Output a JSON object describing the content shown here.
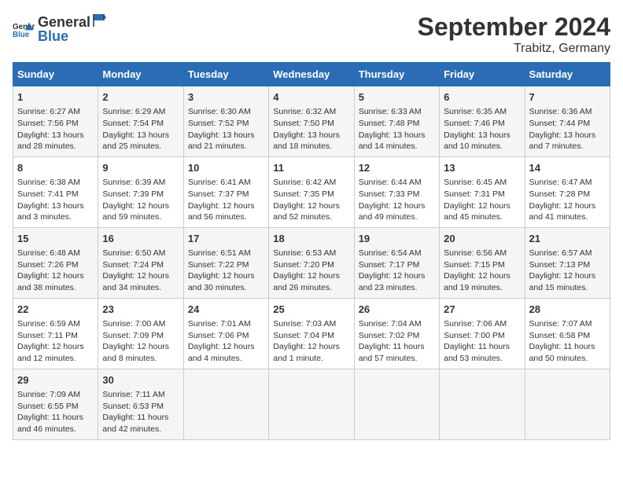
{
  "logo": {
    "general": "General",
    "blue": "Blue"
  },
  "title": "September 2024",
  "subtitle": "Trabitz, Germany",
  "days_header": [
    "Sunday",
    "Monday",
    "Tuesday",
    "Wednesday",
    "Thursday",
    "Friday",
    "Saturday"
  ],
  "weeks": [
    [
      {
        "day": "1",
        "info": "Sunrise: 6:27 AM\nSunset: 7:56 PM\nDaylight: 13 hours\nand 28 minutes."
      },
      {
        "day": "2",
        "info": "Sunrise: 6:29 AM\nSunset: 7:54 PM\nDaylight: 13 hours\nand 25 minutes."
      },
      {
        "day": "3",
        "info": "Sunrise: 6:30 AM\nSunset: 7:52 PM\nDaylight: 13 hours\nand 21 minutes."
      },
      {
        "day": "4",
        "info": "Sunrise: 6:32 AM\nSunset: 7:50 PM\nDaylight: 13 hours\nand 18 minutes."
      },
      {
        "day": "5",
        "info": "Sunrise: 6:33 AM\nSunset: 7:48 PM\nDaylight: 13 hours\nand 14 minutes."
      },
      {
        "day": "6",
        "info": "Sunrise: 6:35 AM\nSunset: 7:46 PM\nDaylight: 13 hours\nand 10 minutes."
      },
      {
        "day": "7",
        "info": "Sunrise: 6:36 AM\nSunset: 7:44 PM\nDaylight: 13 hours\nand 7 minutes."
      }
    ],
    [
      {
        "day": "8",
        "info": "Sunrise: 6:38 AM\nSunset: 7:41 PM\nDaylight: 13 hours\nand 3 minutes."
      },
      {
        "day": "9",
        "info": "Sunrise: 6:39 AM\nSunset: 7:39 PM\nDaylight: 12 hours\nand 59 minutes."
      },
      {
        "day": "10",
        "info": "Sunrise: 6:41 AM\nSunset: 7:37 PM\nDaylight: 12 hours\nand 56 minutes."
      },
      {
        "day": "11",
        "info": "Sunrise: 6:42 AM\nSunset: 7:35 PM\nDaylight: 12 hours\nand 52 minutes."
      },
      {
        "day": "12",
        "info": "Sunrise: 6:44 AM\nSunset: 7:33 PM\nDaylight: 12 hours\nand 49 minutes."
      },
      {
        "day": "13",
        "info": "Sunrise: 6:45 AM\nSunset: 7:31 PM\nDaylight: 12 hours\nand 45 minutes."
      },
      {
        "day": "14",
        "info": "Sunrise: 6:47 AM\nSunset: 7:28 PM\nDaylight: 12 hours\nand 41 minutes."
      }
    ],
    [
      {
        "day": "15",
        "info": "Sunrise: 6:48 AM\nSunset: 7:26 PM\nDaylight: 12 hours\nand 38 minutes."
      },
      {
        "day": "16",
        "info": "Sunrise: 6:50 AM\nSunset: 7:24 PM\nDaylight: 12 hours\nand 34 minutes."
      },
      {
        "day": "17",
        "info": "Sunrise: 6:51 AM\nSunset: 7:22 PM\nDaylight: 12 hours\nand 30 minutes."
      },
      {
        "day": "18",
        "info": "Sunrise: 6:53 AM\nSunset: 7:20 PM\nDaylight: 12 hours\nand 26 minutes."
      },
      {
        "day": "19",
        "info": "Sunrise: 6:54 AM\nSunset: 7:17 PM\nDaylight: 12 hours\nand 23 minutes."
      },
      {
        "day": "20",
        "info": "Sunrise: 6:56 AM\nSunset: 7:15 PM\nDaylight: 12 hours\nand 19 minutes."
      },
      {
        "day": "21",
        "info": "Sunrise: 6:57 AM\nSunset: 7:13 PM\nDaylight: 12 hours\nand 15 minutes."
      }
    ],
    [
      {
        "day": "22",
        "info": "Sunrise: 6:59 AM\nSunset: 7:11 PM\nDaylight: 12 hours\nand 12 minutes."
      },
      {
        "day": "23",
        "info": "Sunrise: 7:00 AM\nSunset: 7:09 PM\nDaylight: 12 hours\nand 8 minutes."
      },
      {
        "day": "24",
        "info": "Sunrise: 7:01 AM\nSunset: 7:06 PM\nDaylight: 12 hours\nand 4 minutes."
      },
      {
        "day": "25",
        "info": "Sunrise: 7:03 AM\nSunset: 7:04 PM\nDaylight: 12 hours\nand 1 minute."
      },
      {
        "day": "26",
        "info": "Sunrise: 7:04 AM\nSunset: 7:02 PM\nDaylight: 11 hours\nand 57 minutes."
      },
      {
        "day": "27",
        "info": "Sunrise: 7:06 AM\nSunset: 7:00 PM\nDaylight: 11 hours\nand 53 minutes."
      },
      {
        "day": "28",
        "info": "Sunrise: 7:07 AM\nSunset: 6:58 PM\nDaylight: 11 hours\nand 50 minutes."
      }
    ],
    [
      {
        "day": "29",
        "info": "Sunrise: 7:09 AM\nSunset: 6:55 PM\nDaylight: 11 hours\nand 46 minutes."
      },
      {
        "day": "30",
        "info": "Sunrise: 7:11 AM\nSunset: 6:53 PM\nDaylight: 11 hours\nand 42 minutes."
      },
      {
        "day": "",
        "info": ""
      },
      {
        "day": "",
        "info": ""
      },
      {
        "day": "",
        "info": ""
      },
      {
        "day": "",
        "info": ""
      },
      {
        "day": "",
        "info": ""
      }
    ]
  ]
}
